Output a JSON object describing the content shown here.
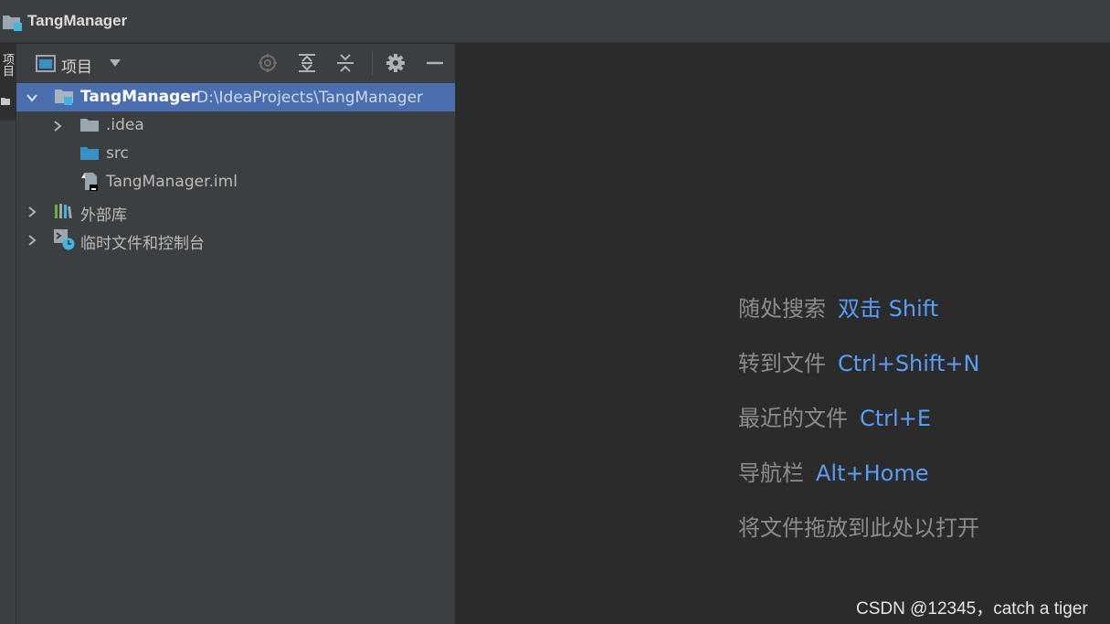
{
  "window": {
    "title": "TangManager"
  },
  "left_strip": {
    "tab_label": "项目"
  },
  "project_panel": {
    "view_label": "项目",
    "toolbar_icons": [
      "locate-icon",
      "expand-all-icon",
      "collapse-all-icon",
      "gear-icon",
      "minimize-icon"
    ]
  },
  "tree": {
    "root": {
      "name": "TangManager",
      "path": "D:\\IdeaProjects\\TangManager"
    },
    "items": [
      {
        "name": ".idea",
        "icon": "folder-icon"
      },
      {
        "name": "src",
        "icon": "source-folder-icon"
      },
      {
        "name": "TangManager.iml",
        "icon": "iml-file-icon"
      },
      {
        "name": "外部库",
        "icon": "library-icon"
      },
      {
        "name": "临时文件和控制台",
        "icon": "scratch-icon"
      }
    ]
  },
  "editor_hints": [
    {
      "text": "随处搜索",
      "key": "双击 Shift"
    },
    {
      "text": "转到文件",
      "key": "Ctrl+Shift+N"
    },
    {
      "text": "最近的文件",
      "key": "Ctrl+E"
    },
    {
      "text": "导航栏",
      "key": "Alt+Home"
    },
    {
      "text": "将文件拖放到此处以打开",
      "key": ""
    }
  ],
  "watermark": "CSDN @12345，catch a tiger",
  "colors": {
    "selection": "#4b6eaf",
    "hint_key": "#589df6",
    "hint_text": "#8c8c8c",
    "panel_bg": "#3c3f41",
    "editor_bg": "#2b2b2b"
  }
}
